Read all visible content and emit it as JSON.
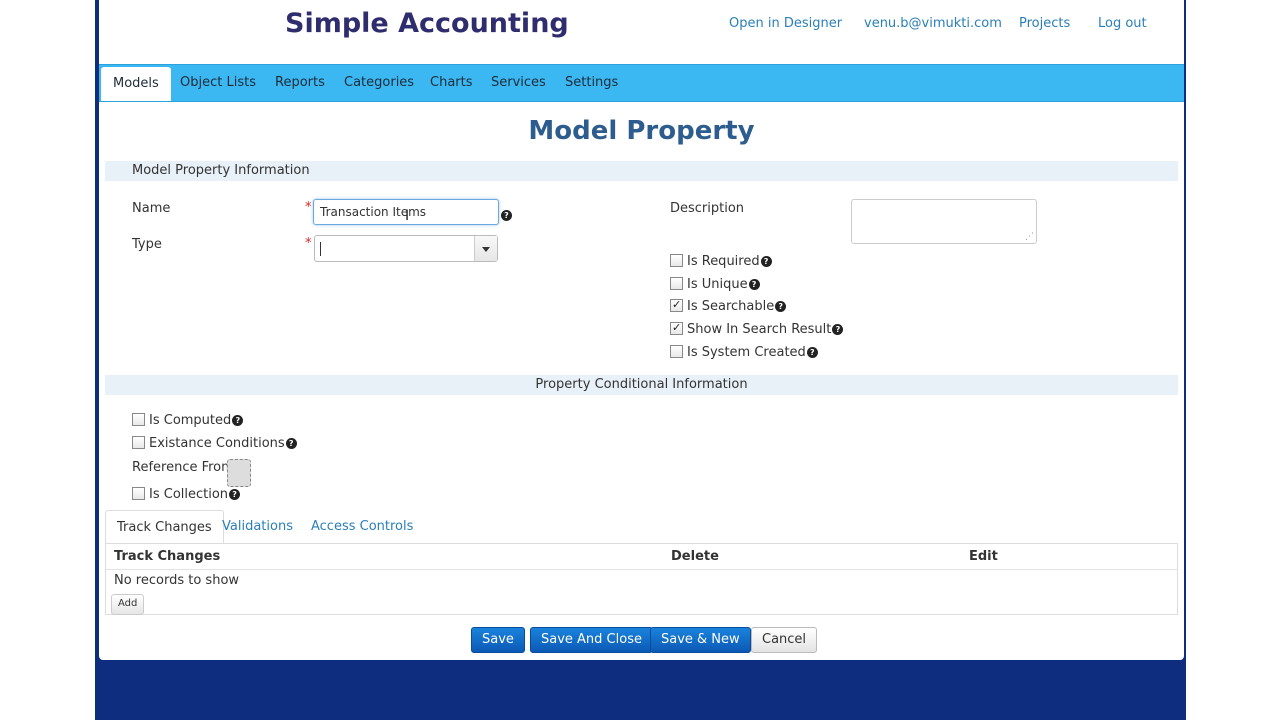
{
  "header": {
    "app_title": "Simple Accounting",
    "links": [
      "Open in Designer",
      "venu.b@vimukti.com",
      "Projects",
      "Log out"
    ]
  },
  "nav": {
    "items": [
      "Models",
      "Object Lists",
      "Reports",
      "Categories",
      "Charts",
      "Services",
      "Settings"
    ],
    "active": "Models"
  },
  "page_title": "Model Property",
  "sections": {
    "info": "Model Property Information",
    "conditional": "Property Conditional Information"
  },
  "form": {
    "name_label": "Name",
    "name_value": "Transaction Items",
    "type_label": "Type",
    "type_value": "",
    "required_mark": "*",
    "description_label": "Description",
    "help_glyph": "?"
  },
  "flags": [
    {
      "label": "Is Required",
      "checked": false
    },
    {
      "label": "Is Unique",
      "checked": false
    },
    {
      "label": "Is Searchable",
      "checked": true
    },
    {
      "label": "Show In Search Result",
      "checked": true
    },
    {
      "label": "Is System Created",
      "checked": false
    }
  ],
  "conditional": {
    "is_computed": {
      "label": "Is Computed",
      "checked": false
    },
    "existance_conditions": {
      "label": "Existance Conditions",
      "checked": false
    },
    "reference_from_label": "Reference From",
    "is_collection": {
      "label": "Is Collection",
      "checked": false
    }
  },
  "tabs": {
    "items": [
      "Track Changes",
      "Validations",
      "Access Controls"
    ],
    "active": "Track Changes"
  },
  "grid": {
    "columns": [
      "Track Changes",
      "Delete",
      "Edit"
    ],
    "empty_text": "No records to show",
    "add_label": "Add"
  },
  "buttons": {
    "save": "Save",
    "save_close": "Save And Close",
    "save_new": "Save & New",
    "cancel": "Cancel"
  },
  "colors": {
    "nav_bg": "#3bb8f2",
    "title": "#2d5d8e",
    "app_title": "#2f2d6e",
    "link": "#2a7fb8",
    "primary_button": "#0b59b5",
    "outer_bg": "#0e2d7e"
  },
  "icons": {
    "help": "question-circle-icon",
    "dropdown": "chevron-down-icon",
    "checkbox": "checkbox-icon",
    "resize": "resize-grip-icon"
  }
}
